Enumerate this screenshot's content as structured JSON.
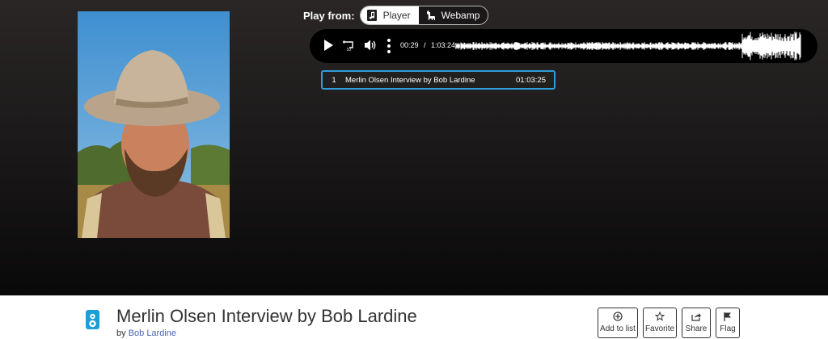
{
  "play_from": {
    "label": "Play from:",
    "options": [
      {
        "label": "Player",
        "icon": "music-file-icon",
        "selected": true
      },
      {
        "label": "Webamp",
        "icon": "llama-icon",
        "selected": false
      }
    ]
  },
  "player": {
    "controls": [
      "play-icon",
      "skip-back-10-icon",
      "volume-icon",
      "more-options-icon"
    ],
    "current_time": "00:29",
    "separator": "/",
    "duration": "1:03:24",
    "progress_fraction": 0.008
  },
  "playlist": [
    {
      "number": "1",
      "title": "Merlin Olsen Interview by Bob Lardine",
      "duration": "01:03:25"
    }
  ],
  "item": {
    "type_icon": "audio-icon",
    "title": "Merlin Olsen Interview by Bob Lardine",
    "by_prefix": "by",
    "creator": "Bob Lardine"
  },
  "actions": [
    {
      "label": "Add to list",
      "icon": "add-circle-icon"
    },
    {
      "label": "Favorite",
      "icon": "star-icon"
    },
    {
      "label": "Share",
      "icon": "share-icon"
    },
    {
      "label": "Flag",
      "icon": "flag-icon"
    }
  ],
  "colors": {
    "accent": "#2e9fd8",
    "link": "#4b64b4",
    "theater_bg": "#1c1a1a"
  }
}
